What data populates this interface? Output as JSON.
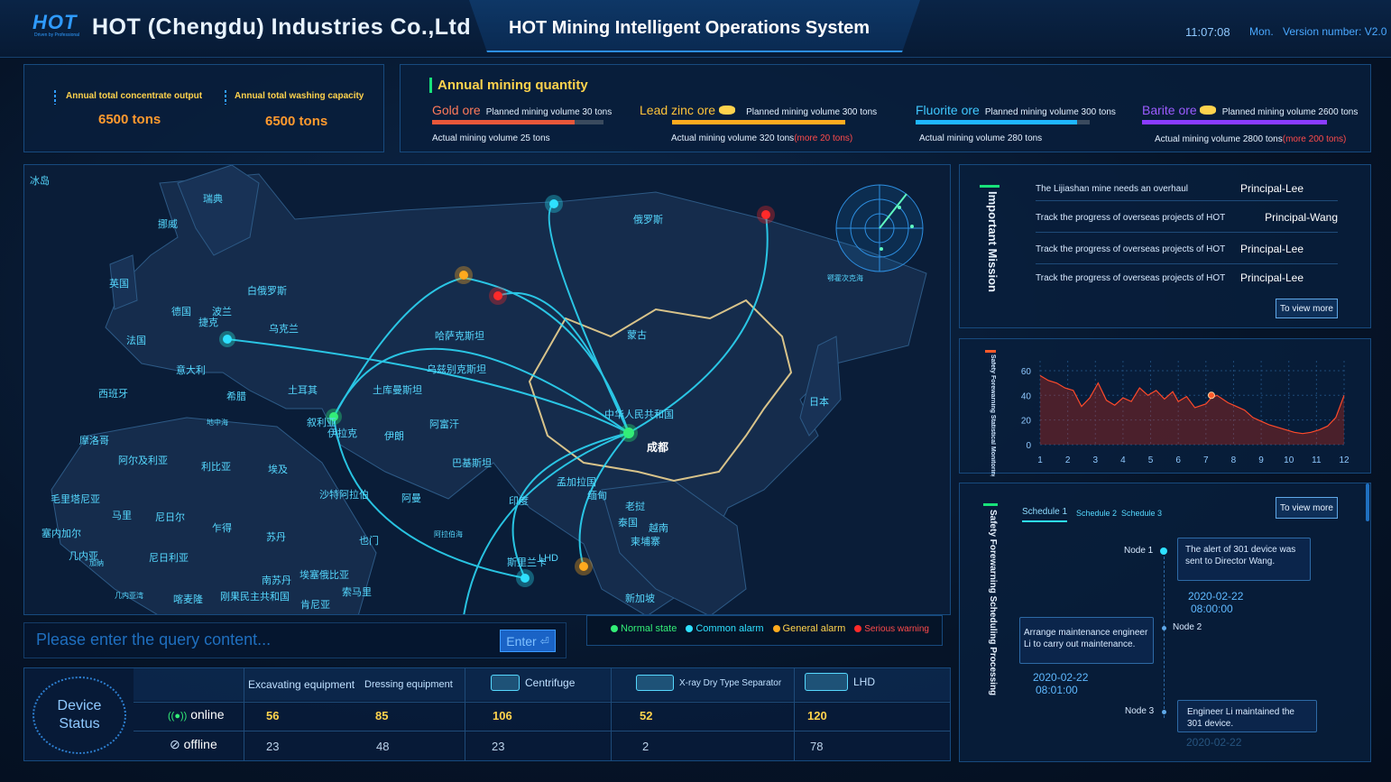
{
  "header": {
    "logo_text": "HOT",
    "logo_tagline": "Driven by Professional",
    "company": "HOT (Chengdu) Industries Co.,Ltd",
    "system_title": "HOT Mining Intelligent Operations System",
    "time": "11:07:08",
    "day": "Mon.",
    "version": "Version number: V2.0"
  },
  "output": {
    "concentrate_label": "Annual total concentrate output",
    "concentrate_value": "6500 tons",
    "washing_label": "Annual total washing capacity",
    "washing_value": "6500 tons"
  },
  "mining": {
    "title": "Annual mining quantity",
    "ores": [
      {
        "name": "Gold ore",
        "planned": "Planned mining volume 30 tons",
        "actual": "Actual mining volume 25 tons",
        "more": "",
        "progress": 0.83,
        "color": "#e8573a",
        "name_color": "#ff7a5a"
      },
      {
        "name": "Lead zinc ore",
        "planned": "Planned mining volume 300 tons",
        "actual": "Actual mining volume 320 tons",
        "more": "(more 20 tons)",
        "progress": 1.0,
        "color": "#ffab1f",
        "name_color": "#ffc43a"
      },
      {
        "name": "Fluorite ore",
        "planned": "Planned mining volume 300 tons",
        "actual": "Actual mining volume 280 tons",
        "more": "",
        "progress": 0.93,
        "color": "#1fb6ff",
        "name_color": "#3fc8ff"
      },
      {
        "name": "Barite ore",
        "planned": "Planned mining volume 2600 tons",
        "actual": "Actual mining volume 2800 tons",
        "more": "(more 200 tons)",
        "progress": 1.0,
        "color": "#8a3cff",
        "name_color": "#9b5cff"
      }
    ]
  },
  "map": {
    "labels": [
      "冰岛",
      "瑞典",
      "挪威",
      "俄罗斯",
      "英国",
      "白俄罗斯",
      "波兰",
      "德国",
      "法国",
      "乌克兰",
      "捷克",
      "意大利",
      "西班牙",
      "希腊",
      "土耳其",
      "哈萨克斯坦",
      "乌兹别克斯坦",
      "土库曼斯坦",
      "蒙古",
      "中华人民共和国",
      "成都",
      "日本",
      "叙利亚",
      "伊拉克",
      "伊朗",
      "阿富汗",
      "巴基斯坦",
      "摩洛哥",
      "阿尔及利亚",
      "利比亚",
      "埃及",
      "沙特阿拉伯",
      "阿曼",
      "印度",
      "孟加拉国",
      "缅甸",
      "泰国",
      "老挝",
      "柬埔寨",
      "越南",
      "毛里塔尼亚",
      "马里",
      "尼日尔",
      "乍得",
      "苏丹",
      "塞内加尔",
      "几内亚",
      "尼日利亚",
      "南苏丹",
      "埃塞俄比亚",
      "索马里",
      "刚果民主共和国",
      "肯尼亚",
      "喀麦隆",
      "也门",
      "斯里兰卡",
      "新加坡",
      "鄂霍次克海",
      "地中海",
      "阿拉伯海",
      "加纳",
      "几内亚湾",
      "LHD"
    ]
  },
  "legend": {
    "normal": "Normal state",
    "common": "Common alarm",
    "general": "General alarm",
    "serious": "Serious warning"
  },
  "search": {
    "placeholder": "Please enter the query content...",
    "button": "Enter"
  },
  "device": {
    "title_line1": "Device",
    "title_line2": "Status",
    "columns": [
      "Excavating equipment",
      "Dressing equipment",
      "Centrifuge",
      "X-ray Dry Type Separator",
      "LHD"
    ],
    "online_label": "online",
    "offline_label": "offline",
    "online": [
      "56",
      "85",
      "106",
      "52",
      "120"
    ],
    "offline": [
      "23",
      "48",
      "23",
      "2",
      "78"
    ]
  },
  "mission": {
    "title": "Important Mission",
    "items": [
      {
        "text": "The Lijiashan mine needs an overhaul",
        "owner": "Principal-Lee"
      },
      {
        "text": "Track the progress of overseas projects of HOT",
        "owner": "Principal-Wang"
      },
      {
        "text": "Track the progress of overseas projects of HOT",
        "owner": "Principal-Lee"
      },
      {
        "text": "Track the progress of overseas projects of HOT",
        "owner": "Principal-Lee"
      }
    ],
    "view_more": "To view more"
  },
  "stat": {
    "title": "Safety Forewarning Statistical Monitoring"
  },
  "chart_data": {
    "type": "area",
    "x": [
      1,
      2,
      3,
      4,
      5,
      6,
      7,
      8,
      9,
      10,
      11,
      12
    ],
    "y_ticks": [
      0,
      20,
      40,
      60
    ],
    "ylim": [
      0,
      68
    ],
    "xlim": [
      1,
      12
    ],
    "series": [
      {
        "color": "#ff4a2a",
        "points": [
          [
            1,
            56
          ],
          [
            1.3,
            52
          ],
          [
            1.6,
            50
          ],
          [
            1.9,
            46
          ],
          [
            2.2,
            44
          ],
          [
            2.5,
            31
          ],
          [
            2.8,
            38
          ],
          [
            3.1,
            50
          ],
          [
            3.4,
            36
          ],
          [
            3.7,
            32
          ],
          [
            4.0,
            38
          ],
          [
            4.3,
            35
          ],
          [
            4.6,
            46
          ],
          [
            4.9,
            40
          ],
          [
            5.2,
            44
          ],
          [
            5.5,
            37
          ],
          [
            5.8,
            43
          ],
          [
            6.0,
            35
          ],
          [
            6.3,
            39
          ],
          [
            6.6,
            30
          ],
          [
            7.0,
            33
          ],
          [
            7.2,
            38
          ],
          [
            7.4,
            40
          ],
          [
            7.8,
            34
          ],
          [
            8.1,
            31
          ],
          [
            8.4,
            28
          ],
          [
            8.7,
            22
          ],
          [
            9.0,
            19
          ],
          [
            9.3,
            16
          ],
          [
            9.6,
            14
          ],
          [
            9.9,
            12
          ],
          [
            10.2,
            10
          ],
          [
            10.5,
            9
          ],
          [
            10.8,
            10
          ],
          [
            11.1,
            12
          ],
          [
            11.4,
            15
          ],
          [
            11.7,
            22
          ],
          [
            12,
            40
          ]
        ]
      }
    ],
    "marker": {
      "x": 7.2,
      "y": 40
    }
  },
  "schedule": {
    "title": "Safety Forewarning Scheduling Processing",
    "tabs": [
      "Schedule 1",
      "Schedule 2",
      "Schedule 3"
    ],
    "view_more": "To view more",
    "nodes": [
      {
        "label": "Node 1",
        "text": "The  alert of 301 device was sent to Director Wang.",
        "date": "2020-02-22",
        "time": "08:00:00"
      },
      {
        "label": "Node 2",
        "text": "Arrange maintenance engineer Li to carry out maintenance.",
        "date": "2020-02-22",
        "time": "08:01:00"
      },
      {
        "label": "Node 3",
        "text": "Engineer Li maintained the 301 device.",
        "date": "2020-02-22",
        "time": ""
      }
    ]
  }
}
